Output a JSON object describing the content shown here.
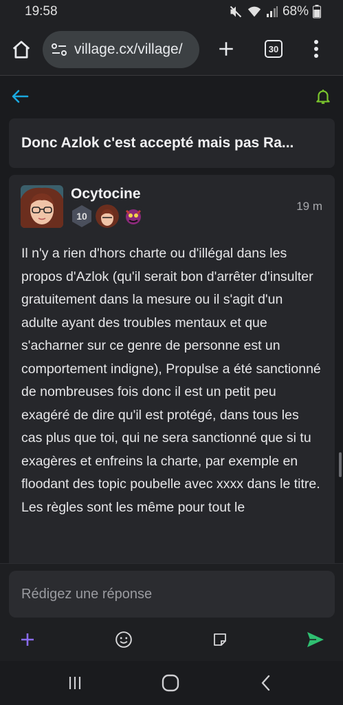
{
  "status": {
    "time": "19:58",
    "battery": "68%"
  },
  "browser": {
    "url": "village.cx/village/",
    "tab_count": "30",
    "icons": [
      "home-icon",
      "site-info-icon",
      "new-tab-icon",
      "tabs-icon",
      "menu-icon"
    ]
  },
  "topic": {
    "title": "Donc Azlok c'est accepté mais pas Ra..."
  },
  "post": {
    "author": "Ocytocine",
    "level": "10",
    "time": "19 m",
    "body": "Il n'y a rien d'hors charte ou d'illégal dans les propos d'Azlok (qu'il serait bon d'arrêter d'insulter gratuitement dans la mesure ou il s'agit d'un adulte ayant des troubles mentaux et que s'acharner sur ce genre de personne est un comportement indigne), Propulse a été sanctionné de nombreuses fois donc il est un petit peu exagéré de dire qu'il est protégé, dans tous les cas plus que toi, qui ne sera sanctionné que si tu exagères et enfreins la charte, par exemple en floodant des topic poubelle avec xxxx dans le titre.\nLes règles sont les même pour tout le"
  },
  "reply": {
    "placeholder": "Rédigez une réponse"
  },
  "colors": {
    "accent_back": "#1aa9e0",
    "bell": "#7bc62d",
    "plus": "#8a6cf0",
    "send": "#2fbf71"
  }
}
